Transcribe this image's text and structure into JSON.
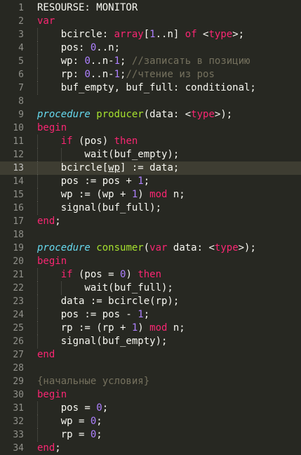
{
  "editor": {
    "lines": [
      {
        "n": "1",
        "t": [
          [
            "RESOURSE: MONITOR",
            "pl"
          ]
        ]
      },
      {
        "n": "2",
        "t": [
          [
            "var",
            "kw"
          ]
        ]
      },
      {
        "n": "3",
        "t": [
          [
            "    bcircle: ",
            "pl"
          ],
          [
            "array",
            "kw"
          ],
          [
            "[",
            "pl"
          ],
          [
            "1",
            "num"
          ],
          [
            "..n] ",
            "pl"
          ],
          [
            "of",
            "kw"
          ],
          [
            " <",
            "pl"
          ],
          [
            "type",
            "kw"
          ],
          [
            ">;",
            "pl"
          ]
        ]
      },
      {
        "n": "4",
        "t": [
          [
            "    pos: ",
            "pl"
          ],
          [
            "0",
            "num"
          ],
          [
            "..n;",
            "pl"
          ]
        ]
      },
      {
        "n": "5",
        "t": [
          [
            "    wp: ",
            "pl"
          ],
          [
            "0",
            "num"
          ],
          [
            "..n-",
            "pl"
          ],
          [
            "1",
            "num"
          ],
          [
            "; ",
            "pl"
          ],
          [
            "//записать в позицию",
            "cm"
          ]
        ]
      },
      {
        "n": "6",
        "t": [
          [
            "    rp: ",
            "pl"
          ],
          [
            "0",
            "num"
          ],
          [
            "..n-",
            "pl"
          ],
          [
            "1",
            "num"
          ],
          [
            ";",
            "pl"
          ],
          [
            "//чтение из pos",
            "cm"
          ]
        ]
      },
      {
        "n": "7",
        "t": [
          [
            "    buf_empty, buf_full: conditional;",
            "pl"
          ]
        ]
      },
      {
        "n": "8",
        "t": []
      },
      {
        "n": "9",
        "t": [
          [
            "procedure",
            "proc"
          ],
          [
            " ",
            "pl"
          ],
          [
            "producer",
            "fn"
          ],
          [
            "(data: <",
            "pl"
          ],
          [
            "type",
            "kw"
          ],
          [
            ">);",
            "pl"
          ]
        ]
      },
      {
        "n": "10",
        "t": [
          [
            "begin",
            "kw"
          ]
        ]
      },
      {
        "n": "11",
        "t": [
          [
            "    ",
            "pl"
          ],
          [
            "if",
            "kw"
          ],
          [
            " (pos) ",
            "pl"
          ],
          [
            "then",
            "kw"
          ]
        ]
      },
      {
        "n": "12",
        "t": [
          [
            "        wait(buf_empty);",
            "pl"
          ]
        ]
      },
      {
        "n": "13",
        "t": [
          [
            "    bcircle[",
            "pl"
          ],
          [
            "wp",
            "ul"
          ],
          [
            "] := data;",
            "pl"
          ]
        ],
        "current": true
      },
      {
        "n": "14",
        "t": [
          [
            "    pos := pos + ",
            "pl"
          ],
          [
            "1",
            "num"
          ],
          [
            ";",
            "pl"
          ]
        ]
      },
      {
        "n": "15",
        "t": [
          [
            "    wp := (wp + ",
            "pl"
          ],
          [
            "1",
            "num"
          ],
          [
            ") ",
            "pl"
          ],
          [
            "mod",
            "kw"
          ],
          [
            " n;",
            "pl"
          ]
        ]
      },
      {
        "n": "16",
        "t": [
          [
            "    signal(buf_full);",
            "pl"
          ]
        ]
      },
      {
        "n": "17",
        "t": [
          [
            "end",
            "kw"
          ],
          [
            ";",
            "pl"
          ]
        ]
      },
      {
        "n": "18",
        "t": []
      },
      {
        "n": "19",
        "t": [
          [
            "procedure",
            "proc"
          ],
          [
            " ",
            "pl"
          ],
          [
            "consumer",
            "fn"
          ],
          [
            "(",
            "pl"
          ],
          [
            "var",
            "kw"
          ],
          [
            " data: <",
            "pl"
          ],
          [
            "type",
            "kw"
          ],
          [
            ">);",
            "pl"
          ]
        ]
      },
      {
        "n": "20",
        "t": [
          [
            "begin",
            "kw"
          ]
        ]
      },
      {
        "n": "21",
        "t": [
          [
            "    ",
            "pl"
          ],
          [
            "if",
            "kw"
          ],
          [
            " (pos = ",
            "pl"
          ],
          [
            "0",
            "num"
          ],
          [
            ") ",
            "pl"
          ],
          [
            "then",
            "kw"
          ]
        ]
      },
      {
        "n": "22",
        "t": [
          [
            "        wait(buf_full);",
            "pl"
          ]
        ]
      },
      {
        "n": "23",
        "t": [
          [
            "    data := bcircle(rp);",
            "pl"
          ]
        ]
      },
      {
        "n": "24",
        "t": [
          [
            "    pos := pos - ",
            "pl"
          ],
          [
            "1",
            "num"
          ],
          [
            ";",
            "pl"
          ]
        ]
      },
      {
        "n": "25",
        "t": [
          [
            "    rp := (rp + ",
            "pl"
          ],
          [
            "1",
            "num"
          ],
          [
            ") ",
            "pl"
          ],
          [
            "mod",
            "kw"
          ],
          [
            " n;",
            "pl"
          ]
        ]
      },
      {
        "n": "26",
        "t": [
          [
            "    signal(buf_empty);",
            "pl"
          ]
        ]
      },
      {
        "n": "27",
        "t": [
          [
            "end",
            "kw"
          ]
        ]
      },
      {
        "n": "28",
        "t": []
      },
      {
        "n": "29",
        "t": [
          [
            "{начальные условия}",
            "cm"
          ]
        ]
      },
      {
        "n": "30",
        "t": [
          [
            "begin",
            "kw"
          ]
        ]
      },
      {
        "n": "31",
        "t": [
          [
            "    pos = ",
            "pl"
          ],
          [
            "0",
            "num"
          ],
          [
            ";",
            "pl"
          ]
        ]
      },
      {
        "n": "32",
        "t": [
          [
            "    wp = ",
            "pl"
          ],
          [
            "0",
            "num"
          ],
          [
            ";",
            "pl"
          ]
        ]
      },
      {
        "n": "33",
        "t": [
          [
            "    rp = ",
            "pl"
          ],
          [
            "0",
            "num"
          ],
          [
            ";",
            "pl"
          ]
        ]
      },
      {
        "n": "34",
        "t": [
          [
            "end",
            "kw"
          ],
          [
            ";",
            "pl"
          ]
        ]
      }
    ]
  }
}
